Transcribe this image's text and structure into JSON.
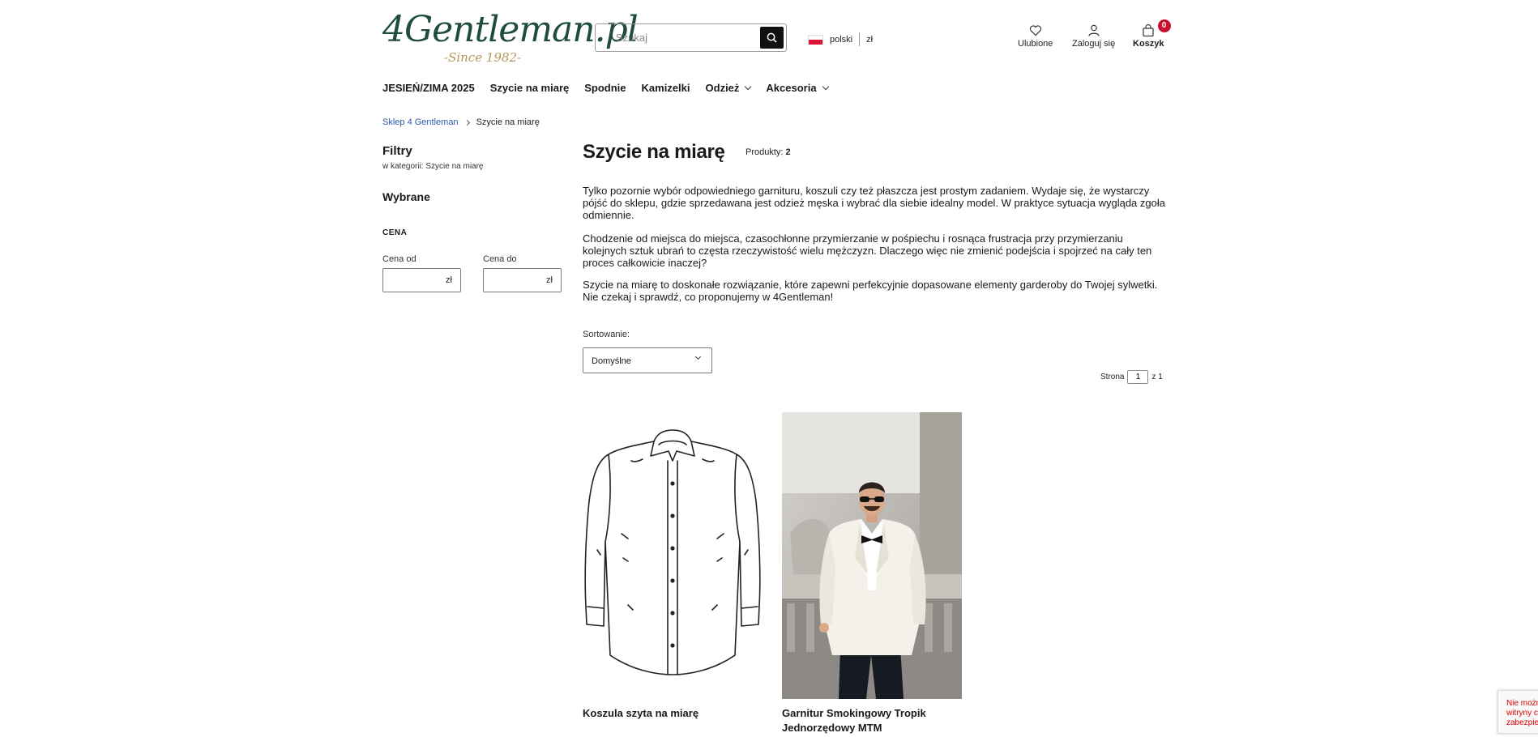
{
  "header": {
    "logo_text": "4Gentleman.pl",
    "logo_sub": "-Since 1982-",
    "search_placeholder": "Szukaj",
    "language": "polski",
    "currency": "zł",
    "favorites_label": "Ulubione",
    "login_label": "Zaloguj się",
    "cart_label": "Koszyk",
    "cart_count": "0"
  },
  "nav": {
    "items": [
      {
        "label": "JESIEŃ/ZIMA 2025",
        "has_dropdown": false
      },
      {
        "label": "Szycie na miarę",
        "has_dropdown": false
      },
      {
        "label": "Spodnie",
        "has_dropdown": false
      },
      {
        "label": "Kamizelki",
        "has_dropdown": false
      },
      {
        "label": "Odzież",
        "has_dropdown": true
      },
      {
        "label": "Akcesoria",
        "has_dropdown": true
      }
    ]
  },
  "breadcrumb": {
    "home": "Sklep 4 Gentleman",
    "current": "Szycie na miarę"
  },
  "sidebar": {
    "title": "Filtry",
    "subtitle": "w kategorii: Szycie na miarę",
    "selected_title": "Wybrane",
    "price_section": "CENA",
    "price_from_label": "Cena od",
    "price_to_label": "Cena do",
    "currency": "zł"
  },
  "main": {
    "title": "Szycie na miarę",
    "count_label": "Produkty:",
    "count_value": "2",
    "paragraphs": [
      "Tylko pozornie wybór odpowiedniego garnituru, koszuli czy też płaszcza jest prostym zadaniem. Wydaje się, że wystarczy pójść do sklepu, gdzie sprzedawana jest odzież męska i wybrać dla siebie idealny model. W praktyce sytuacja wygląda zgoła odmiennie.",
      "Chodzenie od miejsca do miejsca, czasochłonne przymierzanie w pośpiechu i rosnąca frustracja przy przymierzaniu kolejnych sztuk ubrań to częsta rzeczywistość wielu mężczyzn. Dlaczego więc nie zmienić podejścia i spojrzeć na cały ten proces całkowicie inaczej?",
      "Szycie na miarę to doskonałe rozwiązanie, które zapewni perfekcyjnie dopasowane elementy garderoby do Twojej sylwetki. Nie czekaj i sprawdź, co proponujemy w 4Gentleman!"
    ],
    "sort_label": "Sortowanie:",
    "sort_value": "Domyślne",
    "page_label": "Strona",
    "page_value": "1",
    "page_total": "z 1"
  },
  "products": [
    {
      "name": "Koszula szyta na miarę",
      "image": "shirt-line-drawing"
    },
    {
      "name": "Garnitur Smokingowy Tropik Jednorzędowy MTM",
      "image": "man-in-white-tuxedo-photo"
    }
  ],
  "recaptcha_text": "Nie możn witryny c zabezpie"
}
